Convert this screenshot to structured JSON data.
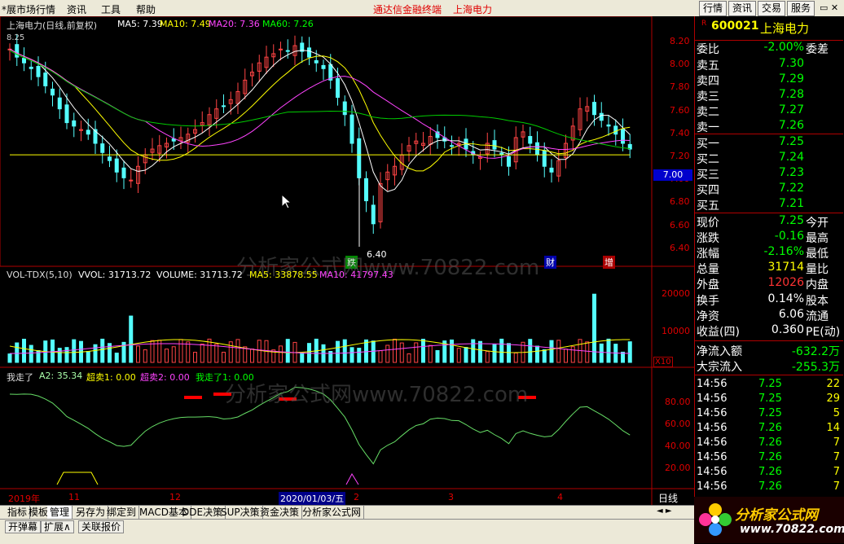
{
  "menubar": {
    "market_label": "*展市场行情",
    "menu": [
      "资讯",
      "工具",
      "帮助"
    ],
    "center": [
      "通达信金融终端",
      "上海电力"
    ],
    "right_buttons": [
      "行情",
      "资讯",
      "交易",
      "服务"
    ]
  },
  "header": {
    "title": "上海电力(日线,前复权)",
    "ma5": "MA5: 7.39",
    "ma10": "MA10: 7.49",
    "ma20": "MA20: 7.36",
    "ma60": "MA60: 7.26",
    "high_mark": "8.25",
    "low_mark": "6.40"
  },
  "price_axis": [
    "8.20",
    "8.00",
    "7.80",
    "7.60",
    "7.40",
    "7.20",
    "7.00",
    "6.80",
    "6.60",
    "6.40"
  ],
  "current_price_tag": "7.00",
  "event_marks": [
    "跌",
    "财",
    "增"
  ],
  "watermark": "分析家公式网www.70822.com",
  "volume": {
    "label": "VOL-TDX(5,10)",
    "vvol": "VVOL: 31713.72",
    "volume": "VOLUME: 31713.72",
    "ma5": "MA5: 33878.55",
    "ma10": "MA10: 41797.43",
    "axis": [
      "20000",
      "10000"
    ],
    "scale": "X10"
  },
  "indicator": {
    "name": "我走了",
    "a2": "A2: 35.34",
    "chaomai1": "超卖1: 0.00",
    "chaomai2": "超卖2: 0.00",
    "wozoule1": "我走了1: 0.00",
    "axis": [
      "80.00",
      "60.00",
      "40.00",
      "20.00"
    ]
  },
  "date_axis": {
    "labels": [
      "2019年",
      "11",
      "12",
      "2020/01/03/五",
      "2",
      "3",
      "4"
    ],
    "period": "日线"
  },
  "quote": {
    "code": "600021",
    "name": "上海电力",
    "weibi_label": "委比",
    "weibi": "-2.00%",
    "weicha_label": "委差",
    "asks": [
      {
        "label": "卖五",
        "price": "7.30"
      },
      {
        "label": "卖四",
        "price": "7.29"
      },
      {
        "label": "卖三",
        "price": "7.28"
      },
      {
        "label": "卖二",
        "price": "7.27"
      },
      {
        "label": "卖一",
        "price": "7.26"
      }
    ],
    "bids": [
      {
        "label": "买一",
        "price": "7.25"
      },
      {
        "label": "买二",
        "price": "7.24"
      },
      {
        "label": "买三",
        "price": "7.23"
      },
      {
        "label": "买四",
        "price": "7.22"
      },
      {
        "label": "买五",
        "price": "7.21"
      }
    ],
    "stats": [
      {
        "k": "现价",
        "v": "7.25",
        "k2": "今开",
        "c": "#00ff00"
      },
      {
        "k": "涨跌",
        "v": "-0.16",
        "k2": "最高",
        "c": "#00ff00"
      },
      {
        "k": "涨幅",
        "v": "-2.16%",
        "k2": "最低",
        "c": "#00ff00"
      },
      {
        "k": "总量",
        "v": "31714",
        "k2": "量比",
        "c": "#ffff00"
      },
      {
        "k": "外盘",
        "v": "12026",
        "k2": "内盘",
        "c": "#ff3333"
      }
    ],
    "stats2": [
      {
        "k": "换手",
        "v": "0.14%",
        "k2": "股本"
      },
      {
        "k": "净资",
        "v": "6.06",
        "k2": "流通"
      },
      {
        "k": "收益(四)",
        "v": "0.360",
        "k2": "PE(动)"
      }
    ],
    "flow": [
      {
        "k": "净流入额",
        "v": "-632.2万"
      },
      {
        "k": "大宗流入",
        "v": "-255.3万"
      }
    ],
    "ticks": [
      {
        "t": "14:56",
        "p": "7.25",
        "v": "22"
      },
      {
        "t": "14:56",
        "p": "7.25",
        "v": "29"
      },
      {
        "t": "14:56",
        "p": "7.25",
        "v": "5"
      },
      {
        "t": "14:56",
        "p": "7.26",
        "v": "14"
      },
      {
        "t": "14:56",
        "p": "7.26",
        "v": "7"
      },
      {
        "t": "14:56",
        "p": "7.26",
        "v": "7"
      },
      {
        "t": "14:56",
        "p": "7.26",
        "v": "7"
      },
      {
        "t": "14:56",
        "p": "7.26",
        "v": "7"
      }
    ]
  },
  "tabs": [
    "指标",
    "模板",
    "管理",
    "另存为",
    "绑定到",
    "MACD基本",
    "DDE决策",
    "SUP决策",
    "资金决策",
    "分析家公式网"
  ],
  "bottom_buttons": [
    "开弹幕",
    "扩展∧",
    "关联报价"
  ],
  "logo": {
    "title": "分析家公式网",
    "url": "www.70822.com"
  }
}
